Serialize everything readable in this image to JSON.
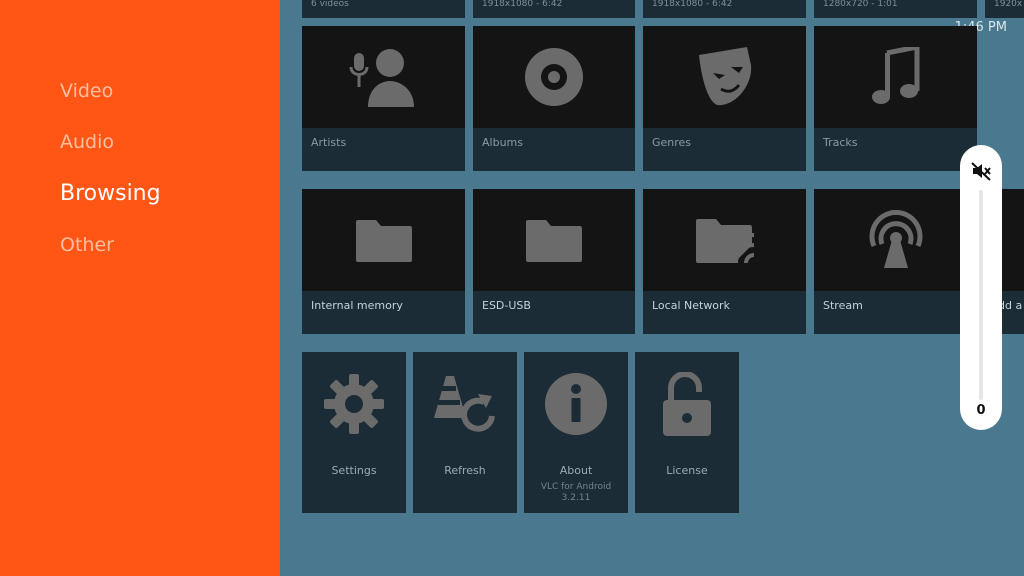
{
  "sidebar": {
    "categories": [
      {
        "label": "Video"
      },
      {
        "label": "Audio"
      },
      {
        "label": "Browsing"
      },
      {
        "label": "Other"
      }
    ],
    "active": "Browsing"
  },
  "status": {
    "time": "1:46 PM"
  },
  "top_row": [
    {
      "label": "6 videos"
    },
    {
      "label": "1918x1080 - 6:42"
    },
    {
      "label": "1918x1080 - 6:42"
    },
    {
      "label": "1280x720 - 1:01"
    },
    {
      "label": "1920x"
    }
  ],
  "audio_row": [
    {
      "label": "Artists",
      "icon": "artist-icon"
    },
    {
      "label": "Albums",
      "icon": "album-icon"
    },
    {
      "label": "Genres",
      "icon": "genre-mask-icon"
    },
    {
      "label": "Tracks",
      "icon": "music-note-icon"
    }
  ],
  "browse_row": [
    {
      "label": "Internal memory",
      "icon": "folder-icon"
    },
    {
      "label": "ESD-USB",
      "icon": "folder-icon"
    },
    {
      "label": "Local Network",
      "icon": "network-folder-icon"
    },
    {
      "label": "Stream",
      "icon": "antenna-icon"
    },
    {
      "label": "dd a"
    }
  ],
  "other_row": [
    {
      "label": "Settings",
      "icon": "gear-icon"
    },
    {
      "label": "Refresh",
      "icon": "refresh-cone-icon"
    },
    {
      "label": "About",
      "icon": "info-icon",
      "sub1": "VLC for Android",
      "sub2": "3.2.11"
    },
    {
      "label": "License",
      "icon": "unlock-icon"
    }
  ],
  "volume": {
    "value": "0",
    "icon": "mute-icon"
  },
  "colors": {
    "sidebar": "#ff5616",
    "background": "#49788f",
    "card": "#1c2c36",
    "volume_panel": "#ffffff"
  }
}
